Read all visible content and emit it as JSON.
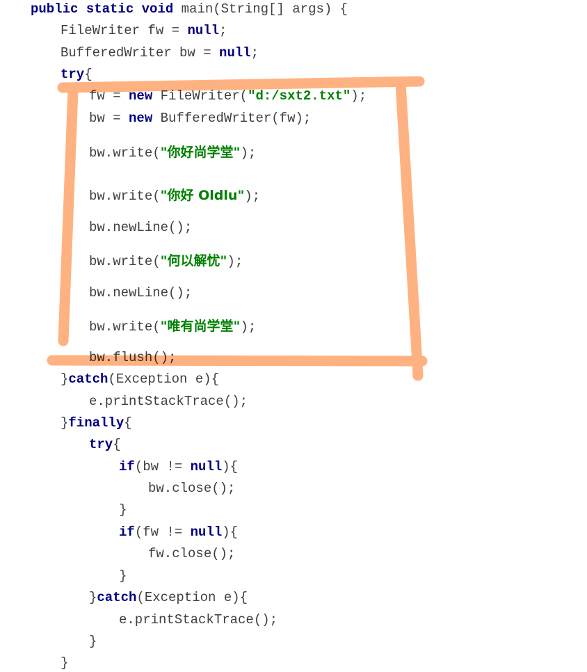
{
  "code": {
    "l1_kw": "public static void",
    "l1_rest": " main(String[] args) {",
    "l2_a": "FileWriter fw = ",
    "l2_kw": "null",
    "l2_b": ";",
    "l3_a": "BufferedWriter bw = ",
    "l3_kw": "null",
    "l3_b": ";",
    "l4_kw": "try",
    "l4_b": "{",
    "l5_a": "fw = ",
    "l5_kw": "new",
    "l5_b": " FileWriter(",
    "l5_str": "\"d:/sxt2.txt\"",
    "l5_c": ");",
    "l6_a": "bw = ",
    "l6_kw": "new",
    "l6_b": " BufferedWriter(fw);",
    "l7_a": "bw.write(",
    "l7_str": "\"你好尚学堂\"",
    "l7_b": ");",
    "l8_a": "bw.write(",
    "l8_str": "\"你好 Oldlu\"",
    "l8_b": ");",
    "l9": "bw.newLine();",
    "l10_a": "bw.write(",
    "l10_str": "\"何以解忧\"",
    "l10_b": ");",
    "l11": "bw.newLine();",
    "l12_a": "bw.write(",
    "l12_str": "\"唯有尚学堂\"",
    "l12_b": ");",
    "l13": "bw.flush();",
    "l14_a": "}",
    "l14_kw": "catch",
    "l14_b": "(Exception e){",
    "l15": "e.printStackTrace();",
    "l16_a": "}",
    "l16_kw": "finally",
    "l16_b": "{",
    "l17_kw": "try",
    "l17_b": "{",
    "l18_kw": "if",
    "l18_a": "(bw != ",
    "l18_kw2": "null",
    "l18_b": "){",
    "l19": "bw.close();",
    "l20": "}",
    "l21_kw": "if",
    "l21_a": "(fw != ",
    "l21_kw2": "null",
    "l21_b": "){",
    "l22": "fw.close();",
    "l23": "}",
    "l24_a": "}",
    "l24_kw": "catch",
    "l24_b": "(Exception e){",
    "l25": "e.printStackTrace();",
    "l26": "}",
    "l27": "}"
  },
  "annotation": {
    "color": "#ffa46b"
  }
}
